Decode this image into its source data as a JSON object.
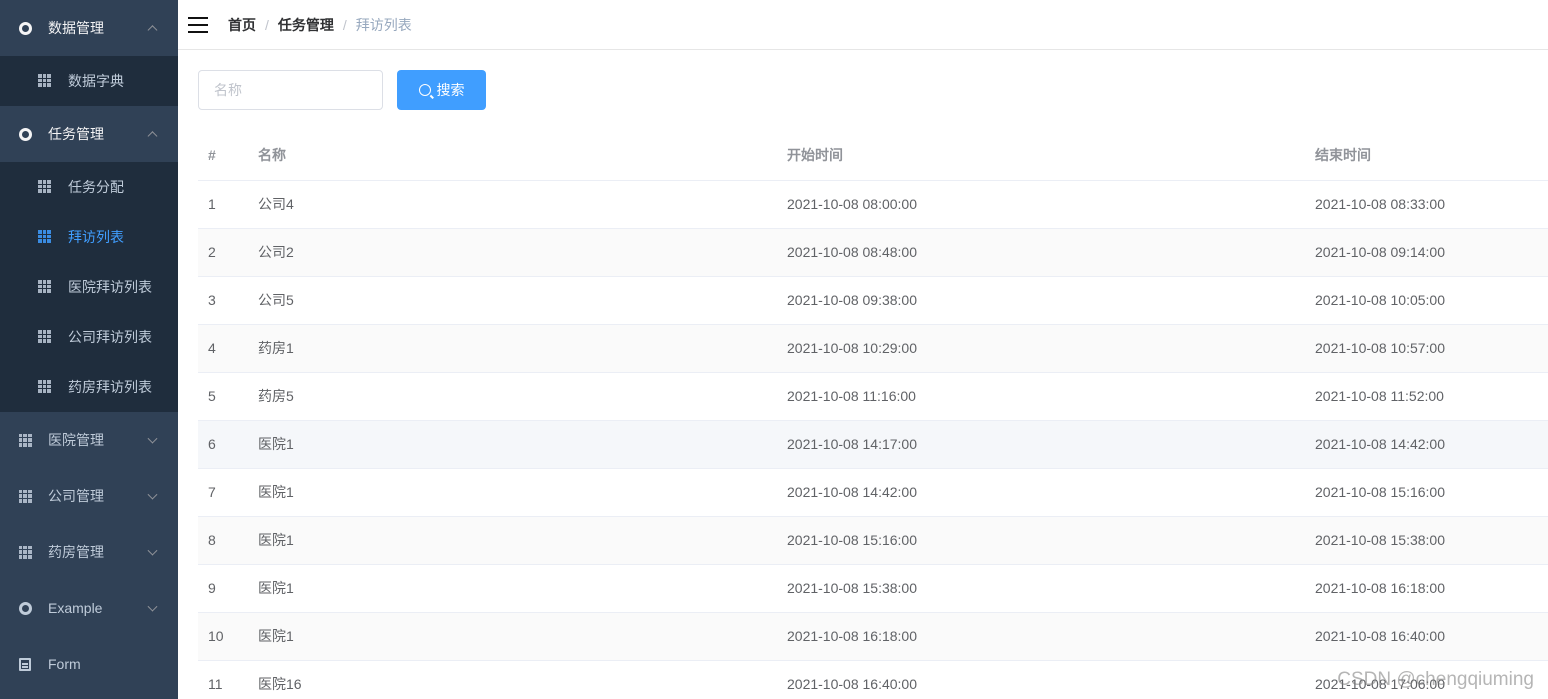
{
  "sidebar": {
    "groups": [
      {
        "label": "数据管理",
        "icon": "gear-icon",
        "expanded": true,
        "children": [
          {
            "label": "数据字典",
            "icon": "table-icon",
            "active": false
          }
        ]
      },
      {
        "label": "任务管理",
        "icon": "gear-icon",
        "expanded": true,
        "children": [
          {
            "label": "任务分配",
            "icon": "table-icon",
            "active": false
          },
          {
            "label": "拜访列表",
            "icon": "table-icon",
            "active": true
          },
          {
            "label": "医院拜访列表",
            "icon": "table-icon",
            "active": false
          },
          {
            "label": "公司拜访列表",
            "icon": "table-icon",
            "active": false
          },
          {
            "label": "药房拜访列表",
            "icon": "table-icon",
            "active": false
          }
        ]
      },
      {
        "label": "医院管理",
        "icon": "table-icon",
        "expanded": false
      },
      {
        "label": "公司管理",
        "icon": "table-icon",
        "expanded": false
      },
      {
        "label": "药房管理",
        "icon": "table-icon",
        "expanded": false
      },
      {
        "label": "Example",
        "icon": "gear-icon",
        "expanded": false
      },
      {
        "label": "Form",
        "icon": "form-icon",
        "expanded": false
      }
    ]
  },
  "navbar": {
    "breadcrumb": [
      "首页",
      "任务管理",
      "拜访列表"
    ]
  },
  "filter": {
    "name_placeholder": "名称",
    "name_value": "",
    "search_label": "搜索"
  },
  "table": {
    "headers": [
      "#",
      "名称",
      "开始时间",
      "结束时间"
    ],
    "rows": [
      [
        "1",
        "公司4",
        "2021-10-08 08:00:00",
        "2021-10-08 08:33:00"
      ],
      [
        "2",
        "公司2",
        "2021-10-08 08:48:00",
        "2021-10-08 09:14:00"
      ],
      [
        "3",
        "公司5",
        "2021-10-08 09:38:00",
        "2021-10-08 10:05:00"
      ],
      [
        "4",
        "药房1",
        "2021-10-08 10:29:00",
        "2021-10-08 10:57:00"
      ],
      [
        "5",
        "药房5",
        "2021-10-08 11:16:00",
        "2021-10-08 11:52:00"
      ],
      [
        "6",
        "医院1",
        "2021-10-08 14:17:00",
        "2021-10-08 14:42:00"
      ],
      [
        "7",
        "医院1",
        "2021-10-08 14:42:00",
        "2021-10-08 15:16:00"
      ],
      [
        "8",
        "医院1",
        "2021-10-08 15:16:00",
        "2021-10-08 15:38:00"
      ],
      [
        "9",
        "医院1",
        "2021-10-08 15:38:00",
        "2021-10-08 16:18:00"
      ],
      [
        "10",
        "医院1",
        "2021-10-08 16:18:00",
        "2021-10-08 16:40:00"
      ],
      [
        "11",
        "医院16",
        "2021-10-08 16:40:00",
        "2021-10-08 17:06:00"
      ]
    ]
  },
  "watermark": "CSDN @chengqiuming",
  "colors": {
    "sidebar_bg": "#304156",
    "submenu_bg": "#1f2d3d",
    "accent": "#409eff"
  }
}
